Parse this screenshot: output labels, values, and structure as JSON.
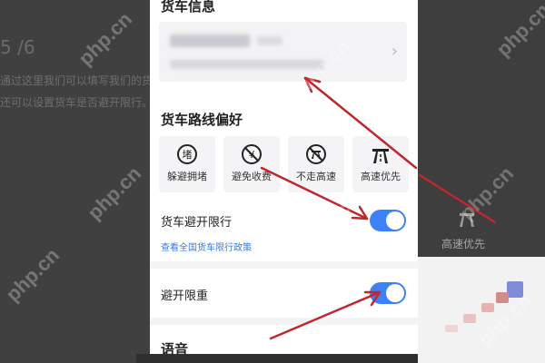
{
  "background": {
    "count_text": "5 /6",
    "line1": "通过这里我们可以填写我们的货车信息",
    "line2": "还可以设置货车是否避开限行。",
    "right_label": "高速优先"
  },
  "panel": {
    "truck_info_title": "货车信息",
    "route_pref_title": "货车路线偏好",
    "options": [
      {
        "label": "躲避拥堵",
        "icon": "congestion-icon"
      },
      {
        "label": "避免收费",
        "icon": "no-toll-icon"
      },
      {
        "label": "不走高速",
        "icon": "no-highway-icon"
      },
      {
        "label": "高速优先",
        "icon": "highway-icon"
      }
    ],
    "avoid_restriction_label": "货车避开限行",
    "avoid_restriction_on": true,
    "policy_link": "查看全国货车限行政策",
    "avoid_weight_label": "避开限重",
    "avoid_weight_on": true,
    "voice_title": "语音"
  },
  "watermark_text": "php.cn",
  "colors": {
    "toggle_on": "#3b82f6",
    "link": "#3a7bd5",
    "arrow": "#c0262d"
  }
}
